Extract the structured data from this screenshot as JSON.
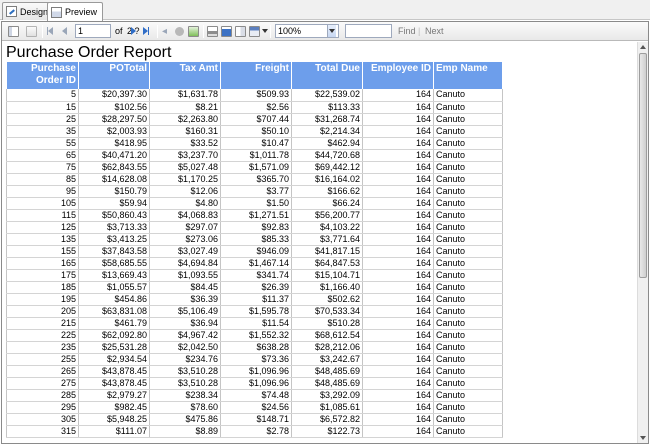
{
  "tabs": [
    {
      "label": "Design",
      "icon": "design-icon"
    },
    {
      "label": "Preview",
      "icon": "preview-icon"
    }
  ],
  "toolbar": {
    "page_value": "1",
    "of_label": "of",
    "total_pages": "2 ?",
    "zoom_value": "100%",
    "find_label": "Find",
    "next_label": "Next"
  },
  "report": {
    "title": "Purchase Order Report",
    "columns": [
      "Purchase Order ID",
      "POTotal",
      "Tax Amt",
      "Freight",
      "Total Due",
      "Employee ID",
      "Emp Name"
    ],
    "rows": [
      [
        "5",
        "$20,397.30",
        "$1,631.78",
        "$509.93",
        "$22,539.02",
        "164",
        "Canuto"
      ],
      [
        "15",
        "$102.56",
        "$8.21",
        "$2.56",
        "$113.33",
        "164",
        "Canuto"
      ],
      [
        "25",
        "$28,297.50",
        "$2,263.80",
        "$707.44",
        "$31,268.74",
        "164",
        "Canuto"
      ],
      [
        "35",
        "$2,003.93",
        "$160.31",
        "$50.10",
        "$2,214.34",
        "164",
        "Canuto"
      ],
      [
        "55",
        "$418.95",
        "$33.52",
        "$10.47",
        "$462.94",
        "164",
        "Canuto"
      ],
      [
        "65",
        "$40,471.20",
        "$3,237.70",
        "$1,011.78",
        "$44,720.68",
        "164",
        "Canuto"
      ],
      [
        "75",
        "$62,843.55",
        "$5,027.48",
        "$1,571.09",
        "$69,442.12",
        "164",
        "Canuto"
      ],
      [
        "85",
        "$14,628.08",
        "$1,170.25",
        "$365.70",
        "$16,164.02",
        "164",
        "Canuto"
      ],
      [
        "95",
        "$150.79",
        "$12.06",
        "$3.77",
        "$166.62",
        "164",
        "Canuto"
      ],
      [
        "105",
        "$59.94",
        "$4.80",
        "$1.50",
        "$66.24",
        "164",
        "Canuto"
      ],
      [
        "115",
        "$50,860.43",
        "$4,068.83",
        "$1,271.51",
        "$56,200.77",
        "164",
        "Canuto"
      ],
      [
        "125",
        "$3,713.33",
        "$297.07",
        "$92.83",
        "$4,103.22",
        "164",
        "Canuto"
      ],
      [
        "135",
        "$3,413.25",
        "$273.06",
        "$85.33",
        "$3,771.64",
        "164",
        "Canuto"
      ],
      [
        "155",
        "$37,843.58",
        "$3,027.49",
        "$946.09",
        "$41,817.15",
        "164",
        "Canuto"
      ],
      [
        "165",
        "$58,685.55",
        "$4,694.84",
        "$1,467.14",
        "$64,847.53",
        "164",
        "Canuto"
      ],
      [
        "175",
        "$13,669.43",
        "$1,093.55",
        "$341.74",
        "$15,104.71",
        "164",
        "Canuto"
      ],
      [
        "185",
        "$1,055.57",
        "$84.45",
        "$26.39",
        "$1,166.40",
        "164",
        "Canuto"
      ],
      [
        "195",
        "$454.86",
        "$36.39",
        "$11.37",
        "$502.62",
        "164",
        "Canuto"
      ],
      [
        "205",
        "$63,831.08",
        "$5,106.49",
        "$1,595.78",
        "$70,533.34",
        "164",
        "Canuto"
      ],
      [
        "215",
        "$461.79",
        "$36.94",
        "$11.54",
        "$510.28",
        "164",
        "Canuto"
      ],
      [
        "225",
        "$62,092.80",
        "$4,967.42",
        "$1,552.32",
        "$68,612.54",
        "164",
        "Canuto"
      ],
      [
        "235",
        "$25,531.28",
        "$2,042.50",
        "$638.28",
        "$28,212.06",
        "164",
        "Canuto"
      ],
      [
        "255",
        "$2,934.54",
        "$234.76",
        "$73.36",
        "$3,242.67",
        "164",
        "Canuto"
      ],
      [
        "265",
        "$43,878.45",
        "$3,510.28",
        "$1,096.96",
        "$48,485.69",
        "164",
        "Canuto"
      ],
      [
        "275",
        "$43,878.45",
        "$3,510.28",
        "$1,096.96",
        "$48,485.69",
        "164",
        "Canuto"
      ],
      [
        "285",
        "$2,979.27",
        "$238.34",
        "$74.48",
        "$3,292.09",
        "164",
        "Canuto"
      ],
      [
        "295",
        "$982.45",
        "$78.60",
        "$24.56",
        "$1,085.61",
        "164",
        "Canuto"
      ],
      [
        "305",
        "$5,948.25",
        "$475.86",
        "$148.71",
        "$6,572.82",
        "164",
        "Canuto"
      ],
      [
        "315",
        "$111.07",
        "$8.89",
        "$2.78",
        "$122.73",
        "164",
        "Canuto"
      ]
    ]
  },
  "colors": {
    "header_bg": "#6d9eeb",
    "header_text": "#ffffff",
    "toolbar_bg": "#ececec"
  }
}
